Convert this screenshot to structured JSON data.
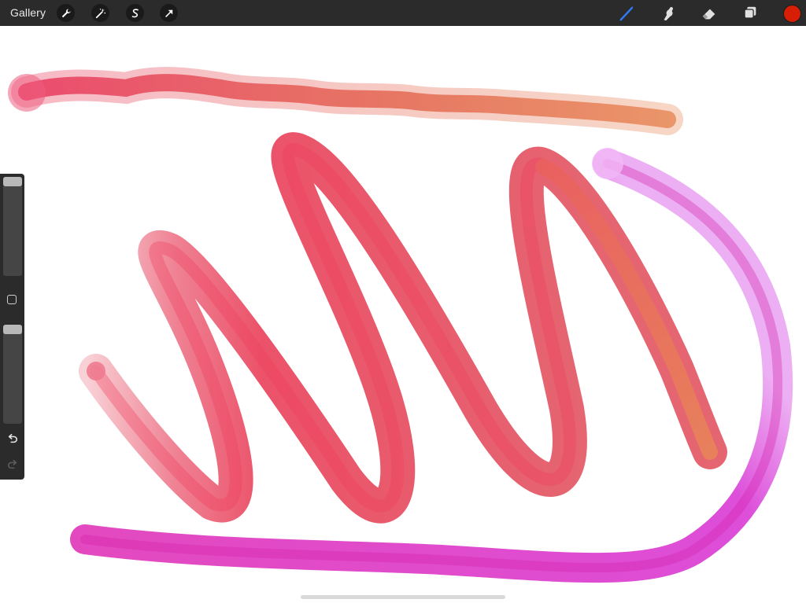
{
  "toolbar": {
    "gallery_label": "Gallery",
    "left_tools": [
      {
        "name": "actions",
        "icon": "wrench-icon"
      },
      {
        "name": "adjustments",
        "icon": "magic-wand-icon"
      },
      {
        "name": "selection",
        "icon": "selection-s-icon"
      },
      {
        "name": "transform",
        "icon": "arrow-cursor-icon"
      }
    ],
    "right_tools": [
      {
        "name": "brush",
        "icon": "brush-icon",
        "active": true
      },
      {
        "name": "smudge",
        "icon": "smudge-finger-icon"
      },
      {
        "name": "eraser",
        "icon": "eraser-icon"
      },
      {
        "name": "layers",
        "icon": "layers-icon"
      }
    ],
    "current_color": "#d81e05"
  },
  "sidebar": {
    "brush_size_level": 0.0,
    "opacity_level": 0.0,
    "modify_icon": "square-icon",
    "undo_icon": "undo-icon",
    "redo_icon": "redo-icon"
  },
  "canvas": {
    "strokes": [
      {
        "name": "wavy-stroke",
        "colors": [
          "#e8375f",
          "#e46a52",
          "#e88a5a"
        ]
      },
      {
        "name": "spiral-stroke",
        "colors": [
          "#f7c9cf",
          "#e8344f",
          "#e04a58"
        ]
      },
      {
        "name": "orange-loop-stroke",
        "colors": [
          "#ea5e60",
          "#e7825a"
        ]
      },
      {
        "name": "magenta-stroke",
        "colors": [
          "#e8a6f0",
          "#e23ad0",
          "#e035b8"
        ]
      }
    ]
  }
}
